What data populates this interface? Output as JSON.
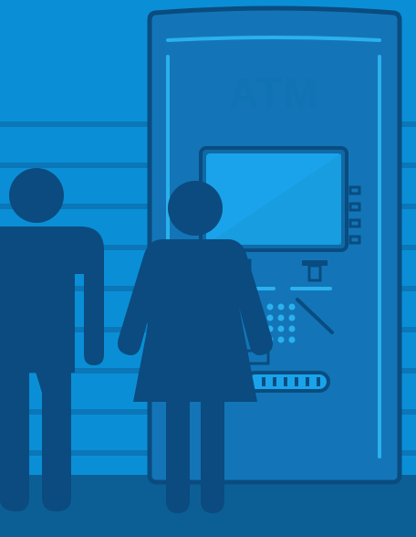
{
  "atm": {
    "sign": "ATM"
  },
  "colors": {
    "sky": "#0a8fd6",
    "wall_stripe": "#0b76b8",
    "floor": "#0c5f94",
    "atm_body": "#1375b7",
    "atm_panel": "#0f6aa7",
    "screen": "#1aa3ea",
    "silhouette": "#0b4b7f",
    "outline": "#0a4c80",
    "sign_text": "#0f73b4"
  }
}
